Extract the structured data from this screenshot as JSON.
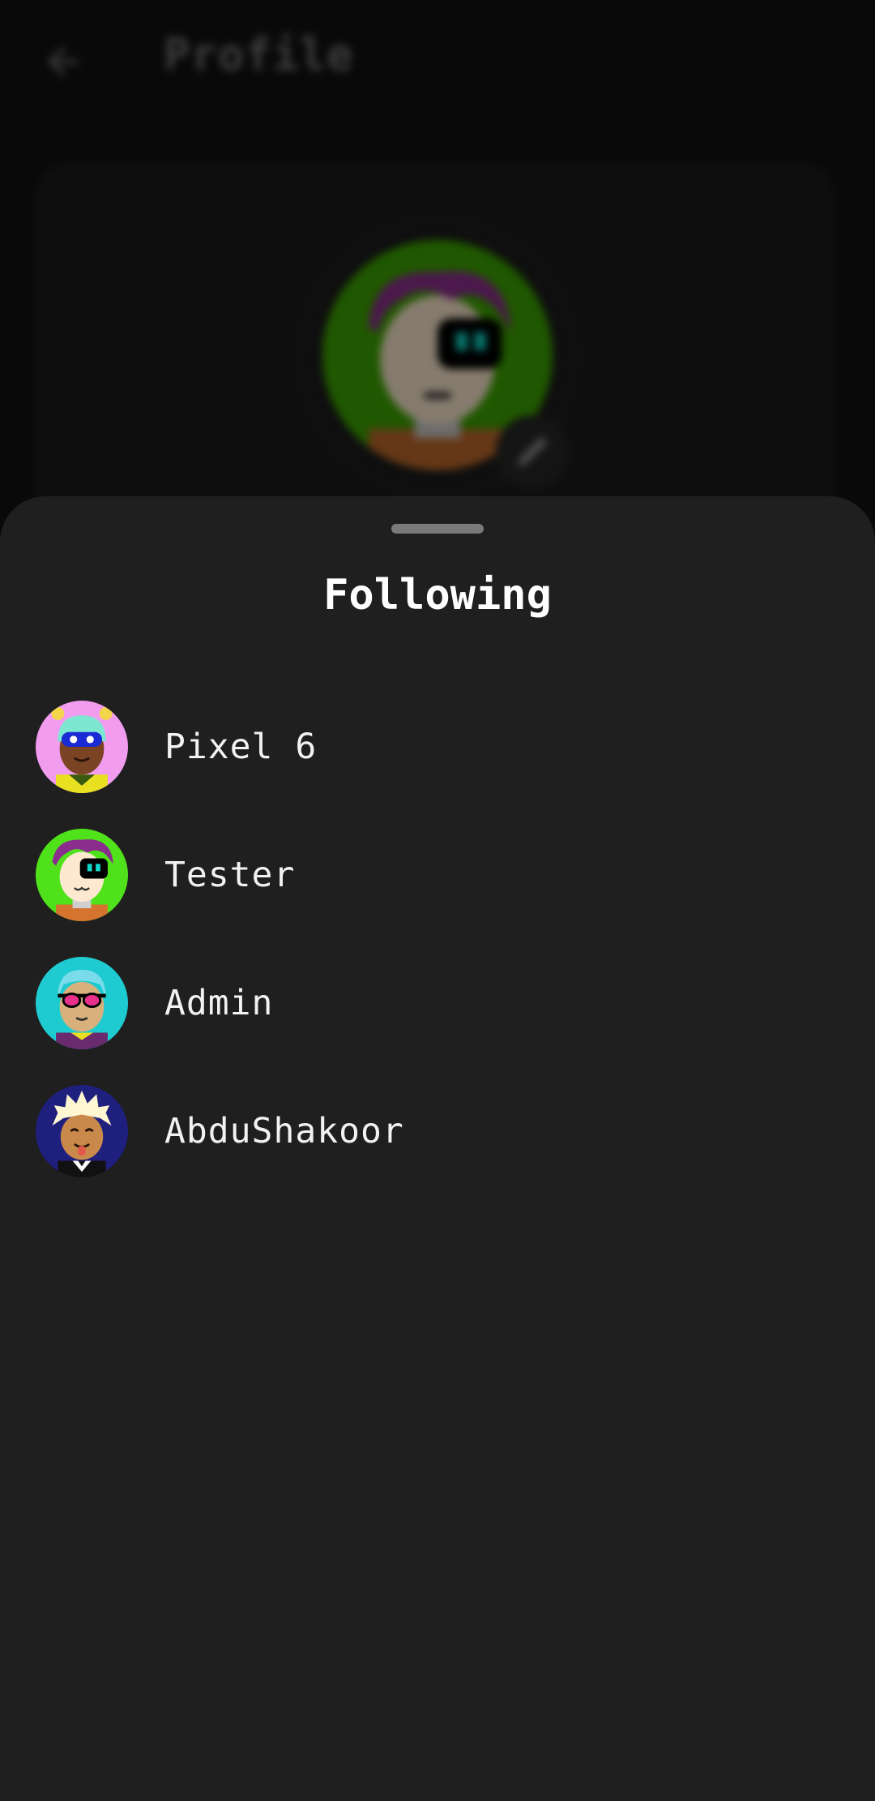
{
  "background": {
    "header": {
      "title": "Profile",
      "back_icon": "arrow-left-icon"
    },
    "avatar_edit_icon": "pencil-icon"
  },
  "sheet": {
    "title": "Following",
    "following": [
      {
        "username": "Pixel 6"
      },
      {
        "username": "Tester"
      },
      {
        "username": "Admin"
      },
      {
        "username": "AbduShakoor"
      }
    ]
  },
  "colors": {
    "sheet_background": "#1f1f1f",
    "page_background": "#121212",
    "text_primary": "#ffffff",
    "handle": "#7a7a7a"
  }
}
